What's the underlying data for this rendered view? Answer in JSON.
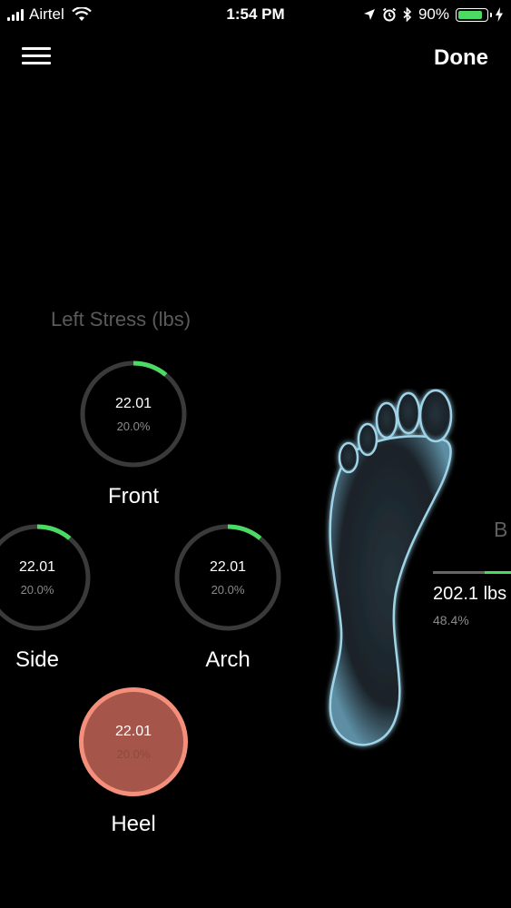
{
  "status": {
    "carrier": "Airtel",
    "time": "1:54 PM",
    "battery_pct": "90%",
    "battery_level": 0.9,
    "icons": [
      "signal-icon",
      "wifi-icon",
      "location-icon",
      "alarm-icon",
      "bluetooth-icon",
      "battery-icon",
      "charging-icon"
    ]
  },
  "header": {
    "menu_icon": "hamburger-menu-icon",
    "done_label": "Done"
  },
  "left_stress": {
    "title": "Left Stress (lbs)",
    "zones": [
      {
        "label": "Front",
        "value": "22.01",
        "percent": "20.0%",
        "ring_fraction": 0.11
      },
      {
        "label": "Side",
        "value": "22.01",
        "percent": "20.0%",
        "ring_fraction": 0.11
      },
      {
        "label": "Arch",
        "value": "22.01",
        "percent": "20.0%",
        "ring_fraction": 0.11
      },
      {
        "label": "Heel",
        "value": "22.01",
        "percent": "20.0%",
        "highlighted": true
      }
    ]
  },
  "right_panel": {
    "partial_title": "B",
    "value": "202.1 lbs",
    "percent": "48.4%"
  },
  "colors": {
    "accent_green": "#4cd964",
    "ring_track": "#3a3a3a",
    "heel_fill": "#a6554a",
    "heel_border": "#f38f7a",
    "foot_glow": "#9fd4e8"
  }
}
